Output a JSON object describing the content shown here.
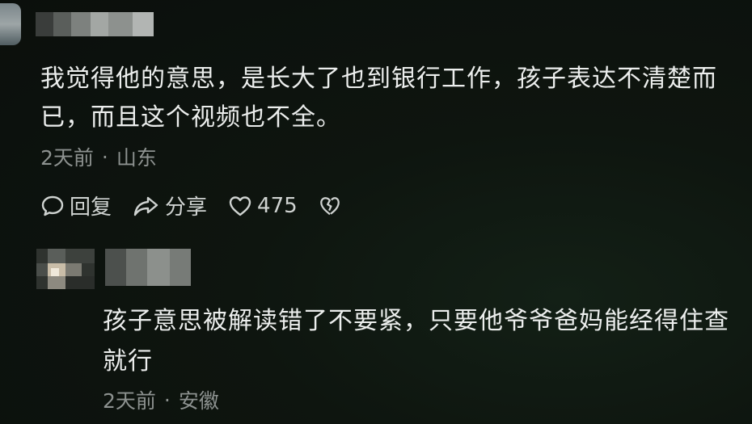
{
  "comments": [
    {
      "text_line1": "我觉得他的意思，是长大了也到银行工作，孩子表达不清楚而",
      "text_line2": "已，而且这个视频也不全。",
      "time": "2天前",
      "separator": "·",
      "location": "山东",
      "actions": {
        "reply_label": "回复",
        "share_label": "分享",
        "like_count": "475"
      }
    },
    {
      "text_line1": "孩子意思被解读错了不要紧，只要他爷爷爸妈能经得住查",
      "text_line2": "就行",
      "time": "2天前",
      "separator": "·",
      "location": "安徽"
    }
  ],
  "colors": {
    "background": "#0d130e",
    "text": "#eceeed",
    "meta": "#8d9290",
    "action": "#cfd3d1"
  },
  "icons": {
    "reply": "speech-bubble-icon",
    "share": "share-arrow-icon",
    "like": "heart-icon",
    "dislike": "broken-heart-icon"
  }
}
